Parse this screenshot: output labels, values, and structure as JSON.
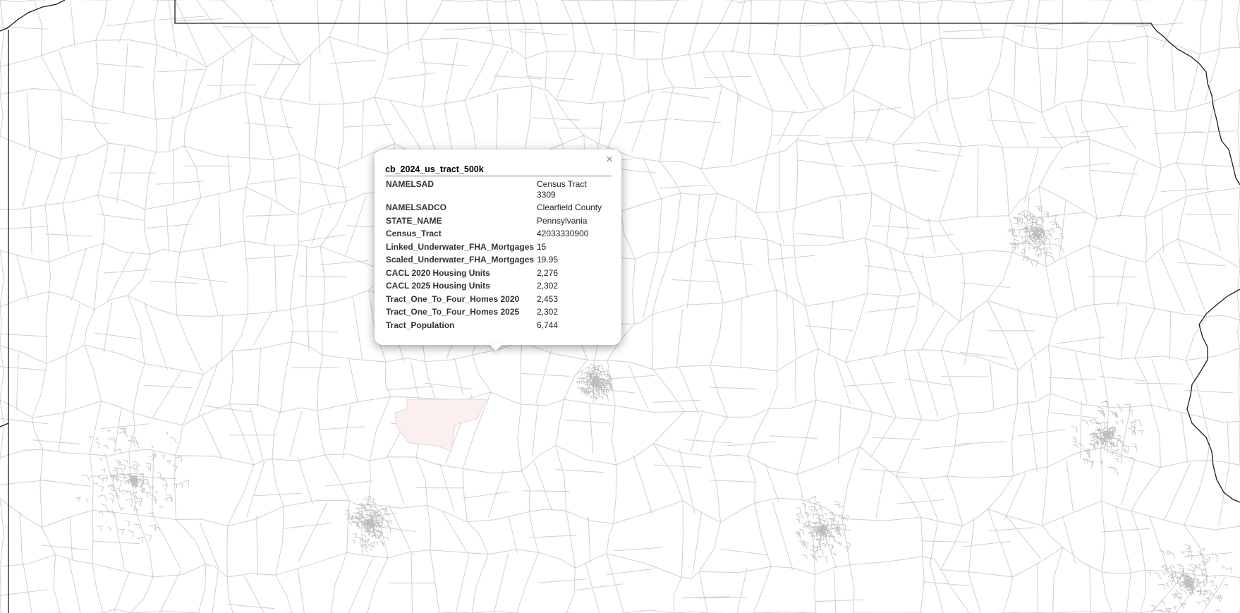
{
  "map": {
    "background": "#ffffff",
    "boundary_color": "#1a1a1a",
    "tract_line_color": "#cfcfcf",
    "highlight_fill": "#fbefef"
  },
  "popup": {
    "title": "cb_2024_us_tract_500k",
    "close_label": "×",
    "rows": [
      {
        "key": "NAMELSAD",
        "value": "Census Tract 3309"
      },
      {
        "key": "NAMELSADCO",
        "value": "Clearfield County"
      },
      {
        "key": "STATE_NAME",
        "value": "Pennsylvania"
      },
      {
        "key": "Census_Tract",
        "value": "42033330900"
      },
      {
        "key": "Linked_Underwater_FHA_Mortgages",
        "value": "15"
      },
      {
        "key": "Scaled_Underwater_FHA_Mortgages",
        "value": "19.95"
      },
      {
        "key": "CACL 2020 Housing Units",
        "value": "2,276"
      },
      {
        "key": "CACL 2025 Housing Units",
        "value": "2,302"
      },
      {
        "key": "Tract_One_To_Four_Homes 2020",
        "value": "2,453"
      },
      {
        "key": "Tract_One_To_Four_Homes 2025",
        "value": "2,302"
      },
      {
        "key": "Tract_Population",
        "value": "6,744"
      }
    ]
  }
}
